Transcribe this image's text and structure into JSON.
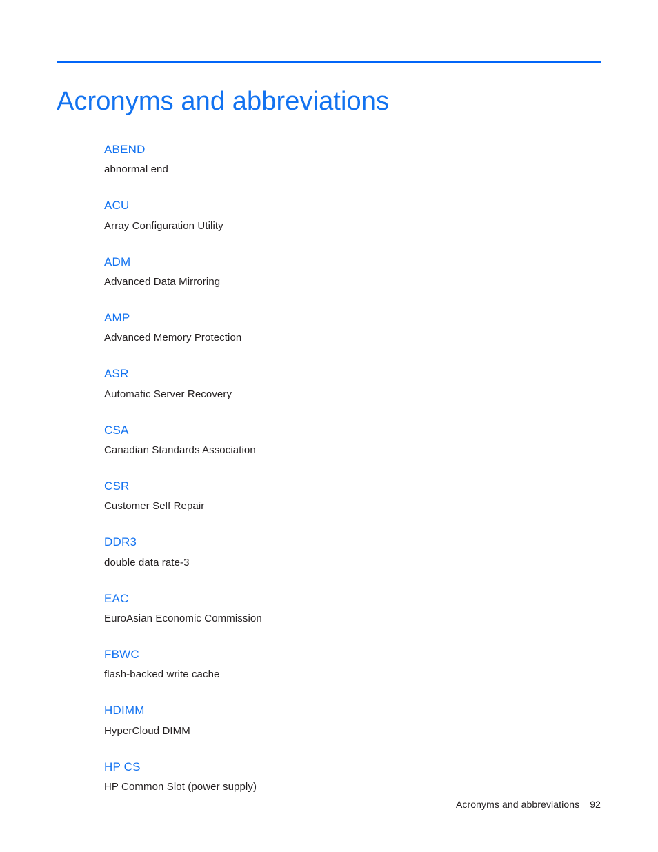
{
  "document": {
    "title": "Acronyms and abbreviations",
    "accent_color": "#1272f0",
    "rule_color": "#0165f8",
    "body_text_color": "#231f20"
  },
  "glossary": {
    "entries": [
      {
        "term": "ABEND",
        "definition": "abnormal end"
      },
      {
        "term": "ACU",
        "definition": "Array Configuration Utility"
      },
      {
        "term": "ADM",
        "definition": "Advanced Data Mirroring"
      },
      {
        "term": "AMP",
        "definition": "Advanced Memory Protection"
      },
      {
        "term": "ASR",
        "definition": "Automatic Server Recovery"
      },
      {
        "term": "CSA",
        "definition": "Canadian Standards Association"
      },
      {
        "term": "CSR",
        "definition": "Customer Self Repair"
      },
      {
        "term": "DDR3",
        "definition": "double data rate-3"
      },
      {
        "term": "EAC",
        "definition": "EuroAsian Economic Commission"
      },
      {
        "term": "FBWC",
        "definition": "flash-backed write cache"
      },
      {
        "term": "HDIMM",
        "definition": "HyperCloud DIMM"
      },
      {
        "term": "HP CS",
        "definition": "HP Common Slot (power supply)"
      }
    ]
  },
  "footer": {
    "title": "Acronyms and abbreviations",
    "page_number": "92"
  }
}
